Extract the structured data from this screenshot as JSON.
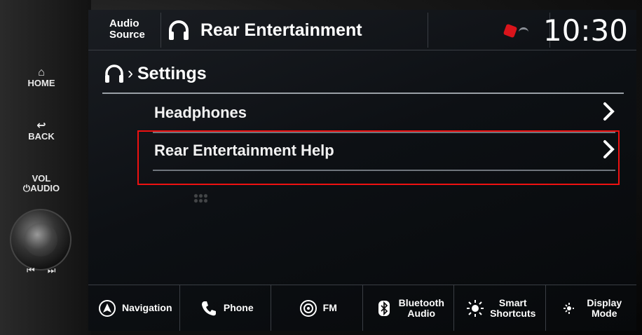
{
  "hardware": {
    "home_label": "HOME",
    "back_label": "BACK",
    "vol_label": "VOL",
    "audio_label": "AUDIO",
    "prev_track": "⏮",
    "next_track": "⏭"
  },
  "header": {
    "audio_source_line1": "Audio",
    "audio_source_line2": "Source",
    "title": "Rear Entertainment",
    "clock": "10:30",
    "title_icon": "headphones-icon"
  },
  "breadcrumb": {
    "icon": "headphones-icon",
    "separator": "›",
    "title": "Settings"
  },
  "menu": {
    "items": [
      {
        "label": "Headphones"
      },
      {
        "label": "Rear Entertainment Help"
      }
    ]
  },
  "dock": {
    "items": [
      {
        "label": "Navigation",
        "icon": "navigation-icon"
      },
      {
        "label": "Phone",
        "icon": "phone-icon"
      },
      {
        "label": "FM",
        "icon": "radio-icon"
      },
      {
        "label_line1": "Bluetooth",
        "label_line2": "Audio",
        "icon": "bluetooth-icon"
      },
      {
        "label_line1": "Smart",
        "label_line2": "Shortcuts",
        "icon": "smart-shortcuts-icon"
      },
      {
        "label_line1": "Display",
        "label_line2": "Mode",
        "icon": "display-mode-icon"
      }
    ]
  },
  "colors": {
    "highlight": "#ee1111",
    "status_red": "#d9141b",
    "divider": "#6f757c"
  }
}
